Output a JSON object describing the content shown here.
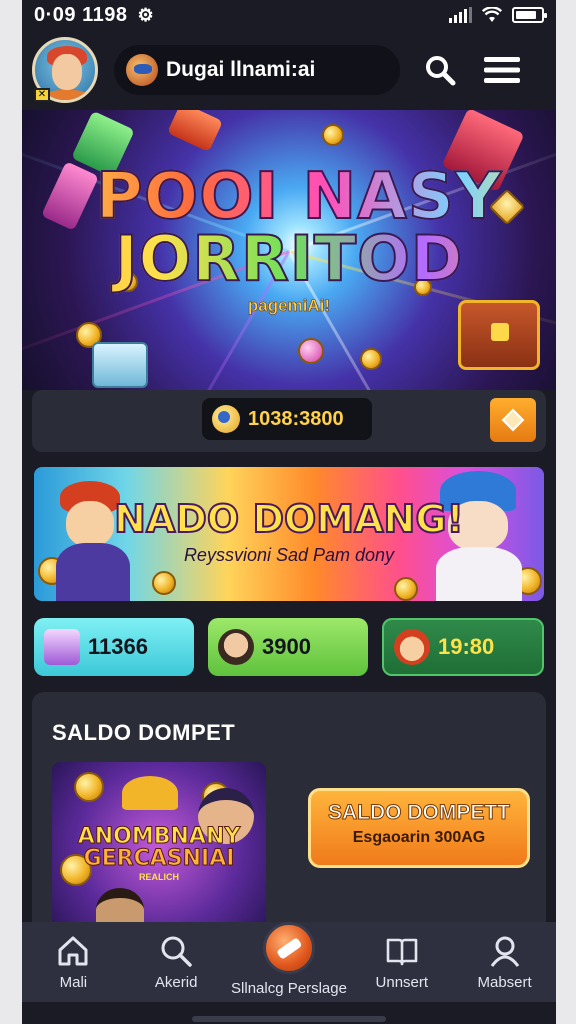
{
  "status": {
    "time": "0·09 1198",
    "battery_level": 0.85
  },
  "header": {
    "username": "Dugai llnami:ai"
  },
  "hero": {
    "title_line1": "POOI NASY",
    "title_line2": "JORRITOD",
    "subtitle": "pagemiAi!"
  },
  "balance": {
    "amount": "1038:3800"
  },
  "promo": {
    "title": "NADO DOMANG!",
    "subtitle": "Reyssvioni Sad Pam dony"
  },
  "stats": [
    {
      "value": "11366",
      "icon": "gift-icon"
    },
    {
      "value": "3900",
      "icon": "avatar-icon"
    },
    {
      "value": "19:80",
      "icon": "avatar-icon"
    }
  ],
  "saldo": {
    "title": "SALDO DOMPET",
    "art_line1": "ANOMBNANY",
    "art_line2": "GERCASNIAI",
    "art_line3": "REALICH",
    "button_line1": "SALDO DOMPETT",
    "button_line2": "Esgaoarin 300AG"
  },
  "nav": [
    {
      "label": "Mali",
      "icon": "home-icon"
    },
    {
      "label": "Akerid",
      "icon": "search-icon"
    },
    {
      "label": "Sllnalcg Perslage",
      "icon": "ticket-icon"
    },
    {
      "label": "Unnsert",
      "icon": "book-icon"
    },
    {
      "label": "Mabsert",
      "icon": "profile-icon"
    }
  ],
  "colors": {
    "accent": "#f07a1a",
    "frame": "#1a1b24",
    "panel": "#2a2c37",
    "gold": "#ffd24a"
  }
}
